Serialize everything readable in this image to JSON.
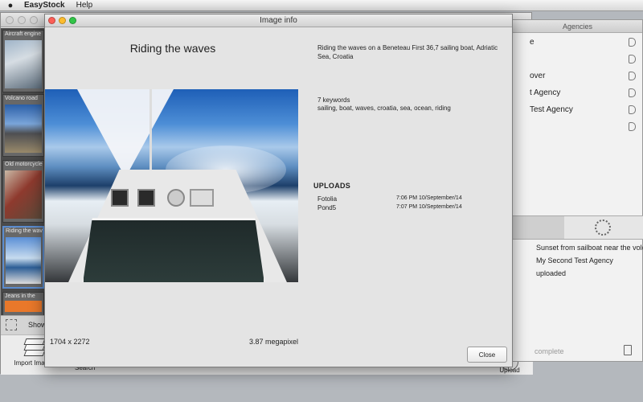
{
  "menubar": {
    "app": "EasyStock",
    "help": "Help"
  },
  "thumbnails": [
    {
      "label": "Aircraft engine"
    },
    {
      "label": "Volcano road"
    },
    {
      "label": "Old motorcycle"
    },
    {
      "label": "Riding the waves"
    },
    {
      "label": "Jeans in the"
    }
  ],
  "main": {
    "show_label": "Show",
    "toolbar": {
      "import_label": "Import Images",
      "search_label": "Search",
      "upload_label": "Upload"
    }
  },
  "agencies": {
    "header": "Agencies",
    "items": [
      {
        "name": "e"
      },
      {
        "name": ""
      },
      {
        "name": "over"
      },
      {
        "name": "t Agency"
      },
      {
        "name": "Test Agency"
      },
      {
        "name": ""
      }
    ],
    "log": [
      "Sunset from sailboat near the volcano",
      "My Second Test Agency",
      "uploaded"
    ],
    "complete_label": "complete"
  },
  "dialog": {
    "title": "Image info",
    "image_title": "Riding the waves",
    "description": "Riding the waves on a Beneteau First 36,7 sailing boat, Adriatic Sea, Croatia",
    "keyword_count": "7 keywords",
    "keywords": "sailing, boat, waves, croatia, sea, ocean, riding",
    "dimensions": "1704 x 2272",
    "megapixel": "3.87 megapixel",
    "uploads_heading": "UPLOADS",
    "uploads": [
      {
        "agency": "Fotolia",
        "time": "7:06 PM 10/September/14"
      },
      {
        "agency": "Pond5",
        "time": "7:07 PM 10/September/14"
      }
    ],
    "close_label": "Close"
  }
}
